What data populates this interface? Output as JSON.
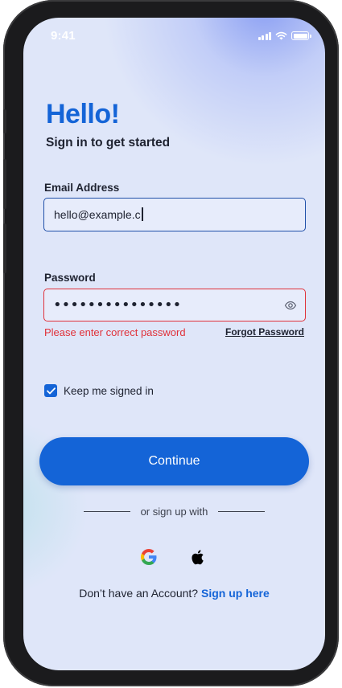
{
  "status_bar": {
    "time": "9:41"
  },
  "header": {
    "title": "Hello!",
    "subtitle": "Sign in to get started"
  },
  "email": {
    "label": "Email Address",
    "value": "hello@example.c"
  },
  "password": {
    "label": "Password",
    "masked_value": "•••••••••••••••",
    "error": "Please enter correct password",
    "forgot_label": "Forgot Password"
  },
  "remember": {
    "label": "Keep me signed in",
    "checked": true
  },
  "continue_label": "Continue",
  "social": {
    "divider_text": "or sign up with",
    "providers": [
      "google-icon",
      "apple-icon"
    ]
  },
  "signup": {
    "prompt": "Don’t have an Account?",
    "link": "Sign up here"
  },
  "colors": {
    "accent": "#1464d7",
    "error": "#e0313a",
    "text": "#1e2230",
    "background": "#dfe6f9"
  }
}
